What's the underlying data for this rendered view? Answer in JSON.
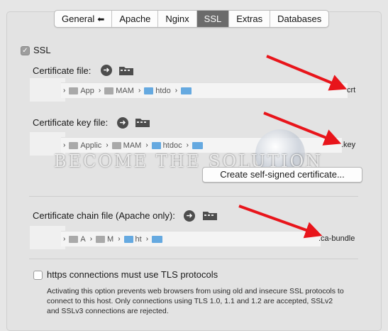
{
  "tabs": [
    {
      "label": "General",
      "icon": "back-arrow-icon",
      "active": false
    },
    {
      "label": "Apache",
      "active": false
    },
    {
      "label": "Nginx",
      "active": false
    },
    {
      "label": "SSL",
      "active": true
    },
    {
      "label": "Extras",
      "active": false
    },
    {
      "label": "Databases",
      "active": false
    }
  ],
  "ssl_checkbox": {
    "label": "SSL",
    "checked": true
  },
  "certificate": {
    "label": "Certificate file:",
    "path": [
      "App",
      "MAM",
      "htdo",
      ""
    ],
    "tail": "crt"
  },
  "certificate_key": {
    "label": "Certificate key file:",
    "path": [
      "Applic",
      "MAM",
      "htdoc",
      ""
    ],
    "tail": ".key"
  },
  "self_signed_button": "Create self-signed certificate...",
  "chain": {
    "label": "Certificate chain file (Apache only):",
    "path": [
      "A",
      "M",
      "ht",
      ""
    ],
    "tail": ".ca-bundle"
  },
  "tls": {
    "label": "https connections must use TLS protocols",
    "checked": false,
    "description": "Activating this option prevents web browsers from using old and insecure SSL protocols to connect to this host. Only connections using TLS 1.0, 1.1 and 1.2 are accepted, SSLv2 and SSLv3 connections are rejected."
  },
  "watermark": "Become The Solution",
  "colors": {
    "arrow": "#e8151b",
    "folder": "#65a9e0",
    "active_tab": "#6b6b6b"
  }
}
